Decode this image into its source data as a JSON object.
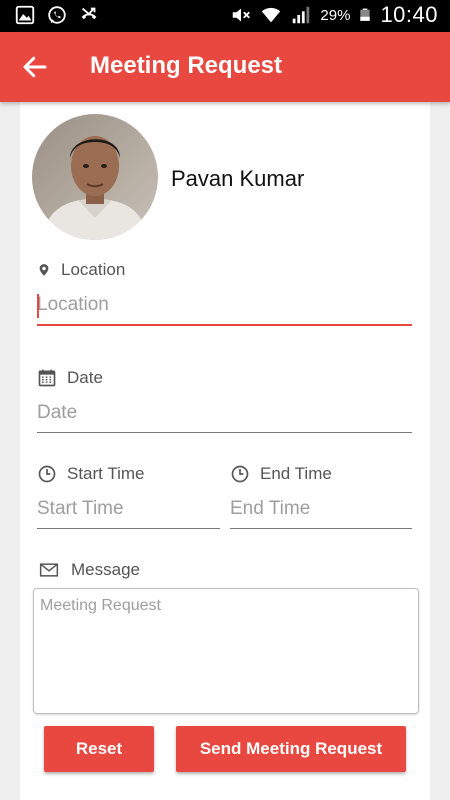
{
  "status_bar": {
    "battery_percent": "29%",
    "time": "10:40",
    "left_icons": [
      "gallery-icon",
      "whatsapp-icon",
      "missed-call-icon"
    ],
    "right_icons": [
      "mute-icon",
      "wifi-icon",
      "signal-icon",
      "battery-icon"
    ]
  },
  "app_bar": {
    "title": "Meeting Request",
    "back_icon": "arrow-left-icon",
    "color": "#e8483f"
  },
  "profile": {
    "name": "Pavan Kumar"
  },
  "form": {
    "location": {
      "label": "Location",
      "icon": "map-pin-icon",
      "placeholder": "Location",
      "value": ""
    },
    "date": {
      "label": "Date",
      "icon": "calendar-icon",
      "placeholder": "Date",
      "value": ""
    },
    "start_time": {
      "label": "Start Time",
      "icon": "clock-icon",
      "placeholder": "Start Time",
      "value": ""
    },
    "end_time": {
      "label": "End Time",
      "icon": "clock-icon",
      "placeholder": "End Time",
      "value": ""
    },
    "message": {
      "label": "Message",
      "icon": "envelope-icon",
      "placeholder": "Meeting Request",
      "value": ""
    }
  },
  "buttons": {
    "reset_label": "Reset",
    "send_label": "Send Meeting Request"
  }
}
